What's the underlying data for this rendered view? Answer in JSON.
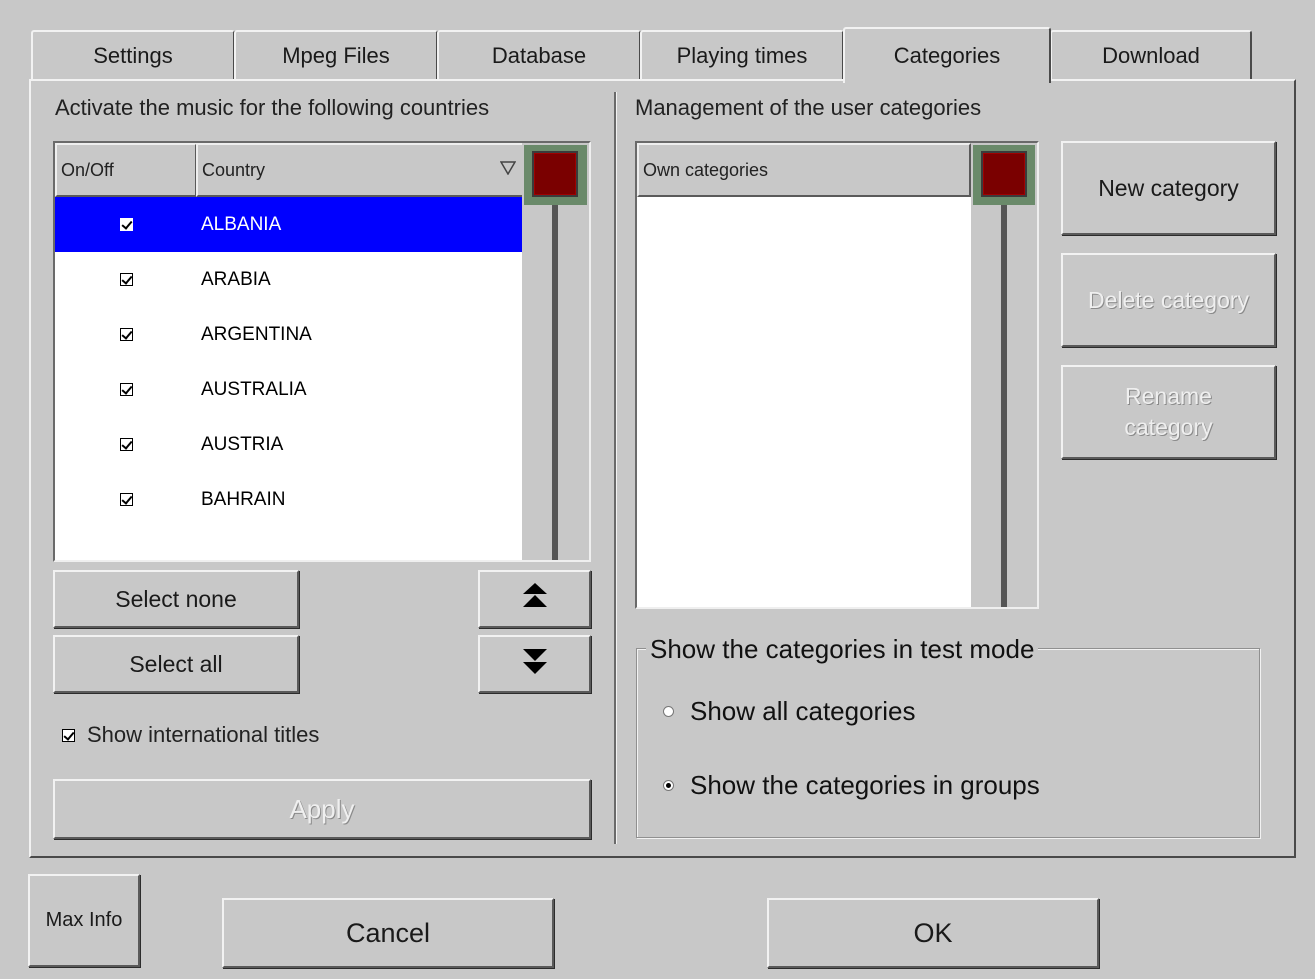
{
  "tabs": [
    {
      "label": "Settings"
    },
    {
      "label": "Mpeg Files"
    },
    {
      "label": "Database"
    },
    {
      "label": "Playing times"
    },
    {
      "label": "Categories"
    },
    {
      "label": "Download"
    }
  ],
  "active_tab": "Categories",
  "countries": {
    "heading": "Activate the music for the following countries",
    "col_onoff": "On/Off",
    "col_country": "Country",
    "rows": [
      {
        "checked": true,
        "name": "ALBANIA",
        "selected": true
      },
      {
        "checked": true,
        "name": "ARABIA"
      },
      {
        "checked": true,
        "name": "ARGENTINA"
      },
      {
        "checked": true,
        "name": "AUSTRALIA"
      },
      {
        "checked": true,
        "name": "AUSTRIA"
      },
      {
        "checked": true,
        "name": "BAHRAIN"
      }
    ],
    "select_none": "Select none",
    "select_all": "Select all",
    "show_intl": "Show international titles",
    "show_intl_checked": true,
    "apply": "Apply",
    "sort_icon": "sort-down-triangle-icon",
    "scroll_up_icon": "double-chevron-up-icon",
    "scroll_down_icon": "double-chevron-down-icon"
  },
  "user_categories": {
    "heading": "Management of the user categories",
    "col_own": "Own categories",
    "new_category": "New category",
    "delete_category": "Delete category",
    "rename_category": "Rename category"
  },
  "test_mode": {
    "title": "Show the categories in test mode",
    "options": [
      {
        "label": "Show all categories",
        "selected": false
      },
      {
        "label": "Show the categories in groups",
        "selected": true
      }
    ]
  },
  "footer": {
    "max_info": "Max Info",
    "cancel": "Cancel",
    "ok": "OK"
  },
  "colors": {
    "background": "#c8c8c8",
    "selection": "#0000ff",
    "scroll_thumb": "#7a0000"
  }
}
